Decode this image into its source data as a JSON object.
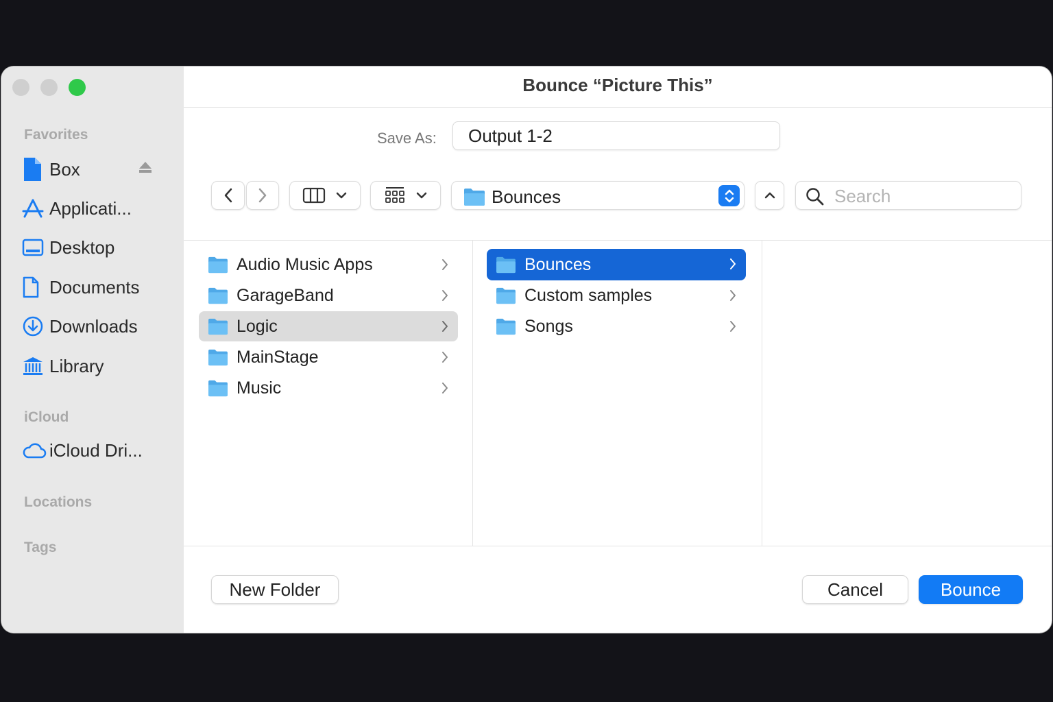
{
  "window": {
    "title": "Bounce “Picture This”"
  },
  "sidebar": {
    "favorites_header": "Favorites",
    "favorites": [
      {
        "label": "Box",
        "icon": "document-icon"
      },
      {
        "label": "Applicati...",
        "icon": "applications-icon"
      },
      {
        "label": "Desktop",
        "icon": "desktop-icon"
      },
      {
        "label": "Documents",
        "icon": "documents-icon"
      },
      {
        "label": "Downloads",
        "icon": "downloads-icon"
      },
      {
        "label": "Library",
        "icon": "library-icon"
      }
    ],
    "icloud_header": "iCloud",
    "icloud": [
      {
        "label": "iCloud Dri...",
        "icon": "cloud-icon"
      }
    ],
    "locations_header": "Locations",
    "tags_header": "Tags"
  },
  "save_as": {
    "label": "Save As:",
    "value": "Output 1-2"
  },
  "toolbar": {
    "location": "Bounces",
    "search_placeholder": "Search"
  },
  "columns": {
    "col1": [
      {
        "label": "Audio Music Apps",
        "state": "normal"
      },
      {
        "label": "GarageBand",
        "state": "normal"
      },
      {
        "label": "Logic",
        "state": "highlighted"
      },
      {
        "label": "MainStage",
        "state": "normal"
      },
      {
        "label": "Music",
        "state": "normal"
      }
    ],
    "col2": [
      {
        "label": "Bounces",
        "state": "selected"
      },
      {
        "label": "Custom samples",
        "state": "normal"
      },
      {
        "label": "Songs",
        "state": "normal"
      }
    ]
  },
  "footer": {
    "new_folder": "New Folder",
    "cancel": "Cancel",
    "bounce": "Bounce"
  },
  "colors": {
    "accent": "#127bf5",
    "selection": "#1566d6",
    "folder": "#5cb8f0",
    "zoom_button": "#2fc94a"
  }
}
